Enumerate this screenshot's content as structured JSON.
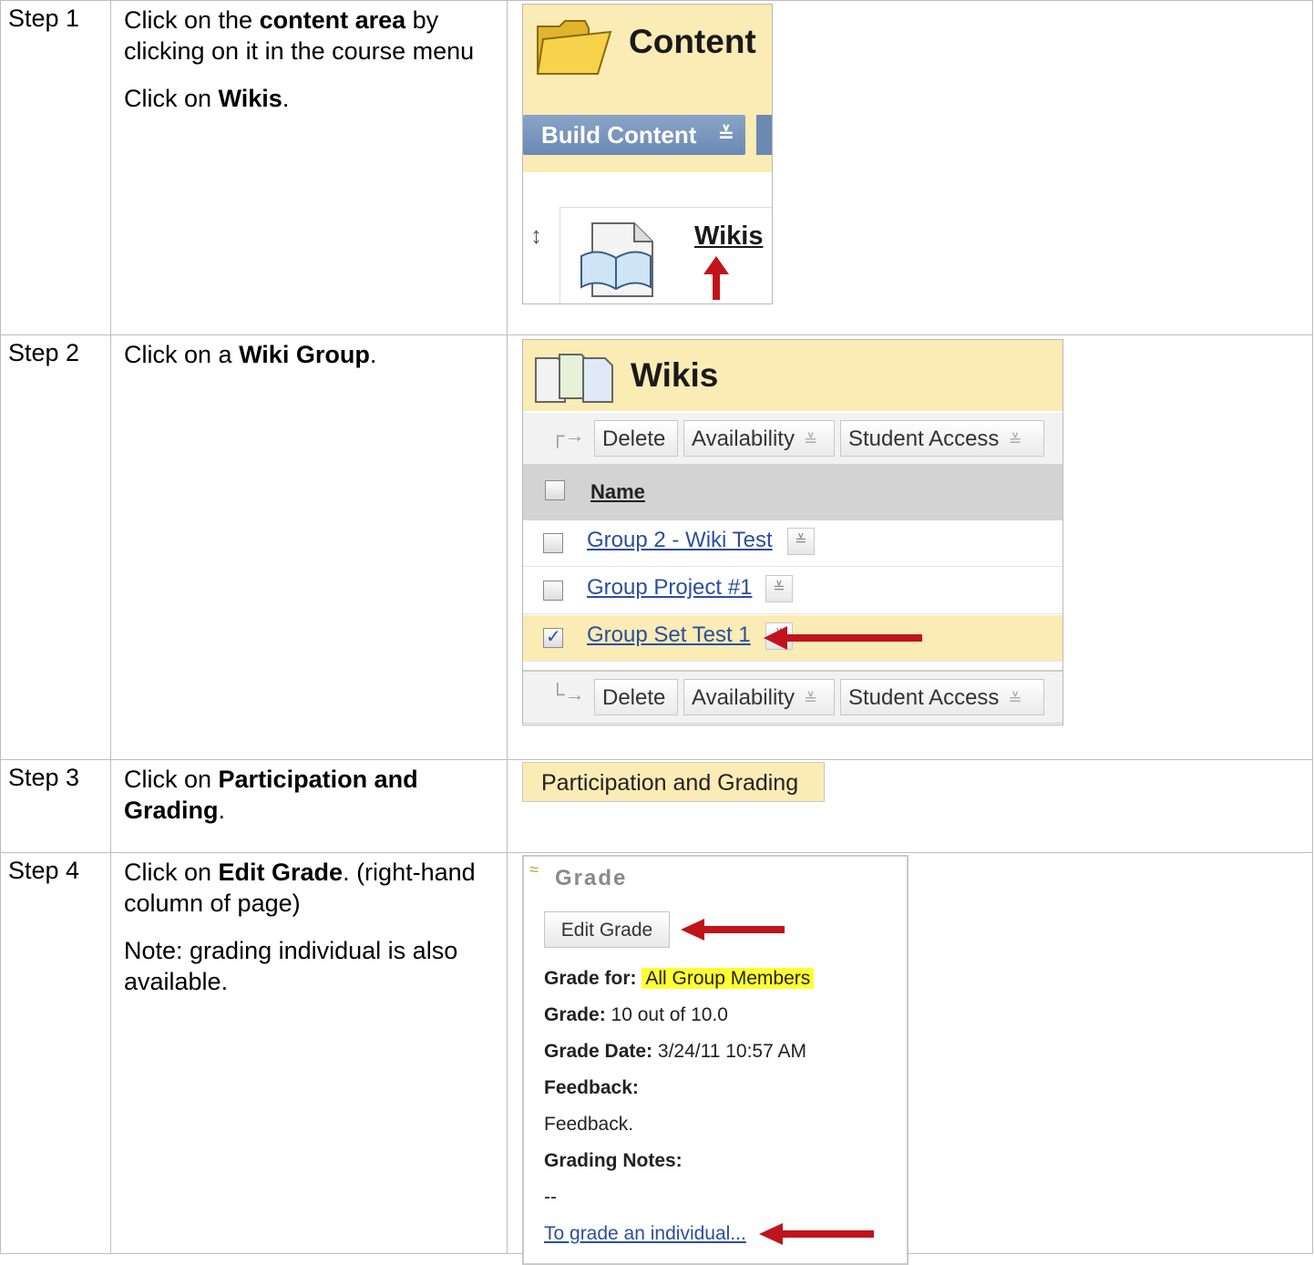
{
  "steps": [
    {
      "label": "Step 1",
      "lines": [
        {
          "pre": "Click on the ",
          "bold": "content area",
          "post": " by clicking on it in the course menu"
        },
        {
          "pre": "Click on ",
          "bold": "Wikis",
          "post": "."
        }
      ],
      "shot": {
        "title": "Content",
        "build_button": "Build Content",
        "wikis_link": "Wikis"
      }
    },
    {
      "label": "Step 2",
      "lines": [
        {
          "pre": "Click on a ",
          "bold": "Wiki Group",
          "post": "."
        }
      ],
      "shot": {
        "title": "Wikis",
        "actions": [
          "Delete",
          "Availability",
          "Student Access"
        ],
        "column_header": "Name",
        "rows": [
          {
            "name": "Group 2 - Wiki Test",
            "checked": false
          },
          {
            "name": "Group Project #1",
            "checked": false
          },
          {
            "name": "Group Set Test 1",
            "checked": true
          }
        ]
      }
    },
    {
      "label": "Step 3",
      "lines": [
        {
          "pre": "Click on ",
          "bold": "Participation and Grading",
          "post": "."
        }
      ],
      "shot": {
        "button": "Participation and Grading"
      }
    },
    {
      "label": "Step 4",
      "lines": [
        {
          "pre": "Click on ",
          "bold": "Edit Grade",
          "post": ". (right-hand column of page)"
        },
        {
          "pre": "Note: grading individual is also available.",
          "bold": "",
          "post": ""
        }
      ],
      "shot": {
        "title": "Grade",
        "edit_button": "Edit Grade",
        "grade_for_label": "Grade for:",
        "grade_for_value": "All Group Members",
        "grade_label": "Grade:",
        "grade_value": "10 out of 10.0",
        "grade_date_label": "Grade Date:",
        "grade_date_value": "3/24/11 10:57 AM",
        "feedback_label": "Feedback:",
        "feedback_value": "Feedback.",
        "notes_label": "Grading Notes:",
        "notes_value": "--",
        "individual_link": "To grade an individual..."
      }
    }
  ],
  "colors": {
    "header_bg": "#fbebb5",
    "link": "#2b4f9e",
    "arrow_red": "#c0141b",
    "highlight": "#ffff33"
  }
}
